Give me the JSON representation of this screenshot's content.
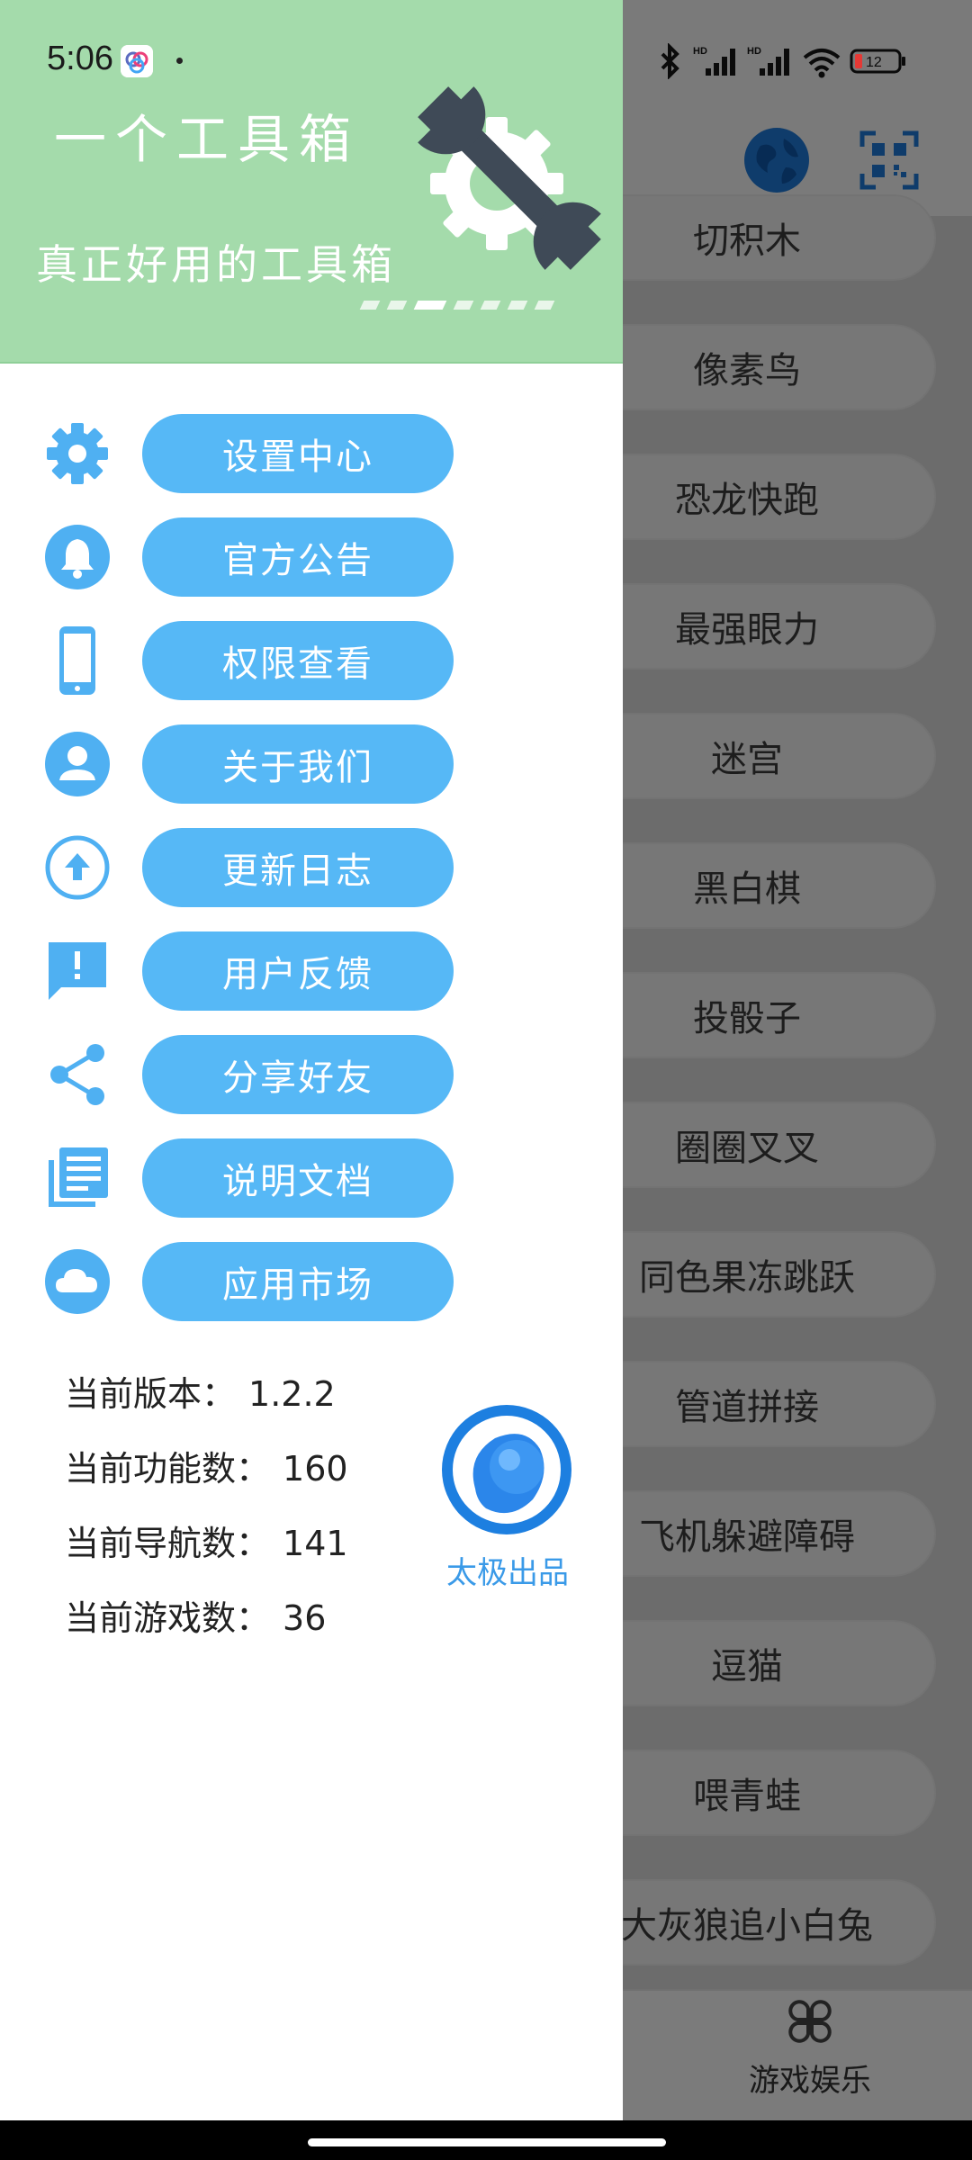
{
  "status_bar": {
    "time": "5:06",
    "battery": "12"
  },
  "background_app": {
    "list_items": [
      "切积木",
      "像素鸟",
      "恐龙快跑",
      "最强眼力",
      "迷宫",
      "黑白棋",
      "投骰子",
      "圈圈叉叉",
      "同色果冻跳跃",
      "管道拼接",
      "飞机躲避障碍",
      "逗猫",
      "喂青蛙",
      "大灰狼追小白兔"
    ],
    "bottom_tab_label": "游戏娱乐"
  },
  "drawer": {
    "header": {
      "title": "一个工具箱",
      "subtitle": "真正好用的工具箱",
      "bg_color": "#a4dbab"
    },
    "menu": [
      {
        "label": "设置中心",
        "icon": "gear-icon"
      },
      {
        "label": "官方公告",
        "icon": "bell-icon"
      },
      {
        "label": "权限查看",
        "icon": "phone-icon"
      },
      {
        "label": "关于我们",
        "icon": "person-icon"
      },
      {
        "label": "更新日志",
        "icon": "upload-icon"
      },
      {
        "label": "用户反馈",
        "icon": "feedback-icon"
      },
      {
        "label": "分享好友",
        "icon": "share-icon"
      },
      {
        "label": "说明文档",
        "icon": "document-icon"
      },
      {
        "label": "应用市场",
        "icon": "cloud-icon"
      }
    ],
    "accent_color": "#56b8f6",
    "info": [
      {
        "key": "当前版本：",
        "value": "1.2.2"
      },
      {
        "key": "当前功能数：",
        "value": "160"
      },
      {
        "key": "当前导航数：",
        "value": "141"
      },
      {
        "key": "当前游戏数：",
        "value": "36"
      }
    ],
    "brand_label": "太极出品"
  }
}
